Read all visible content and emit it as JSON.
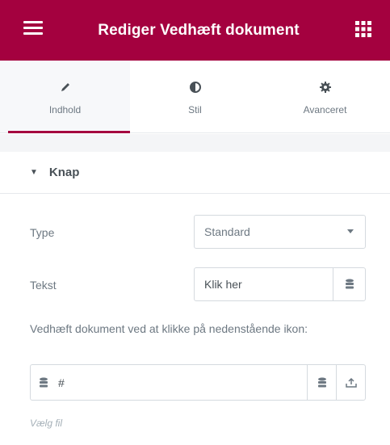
{
  "header": {
    "title": "Rediger Vedhæft dokument",
    "menu_icon": "hamburger-icon",
    "apps_icon": "grid-icon",
    "color": "#a4013f"
  },
  "tabs": [
    {
      "label": "Indhold",
      "icon": "pencil-icon",
      "active": true
    },
    {
      "label": "Stil",
      "icon": "half-circle-icon",
      "active": false
    },
    {
      "label": "Avanceret",
      "icon": "gear-icon",
      "active": false
    }
  ],
  "section": {
    "title": "Knap",
    "caret_icon": "caret-down-icon"
  },
  "controls": {
    "type_label": "Type",
    "type_value": "Standard",
    "text_label": "Tekst",
    "text_value": "Klik her",
    "attach_label": "Vedhæft dokument ved at klikke på nedenstående ikon:",
    "attach_value": "#",
    "hint": "Vælg fil"
  }
}
